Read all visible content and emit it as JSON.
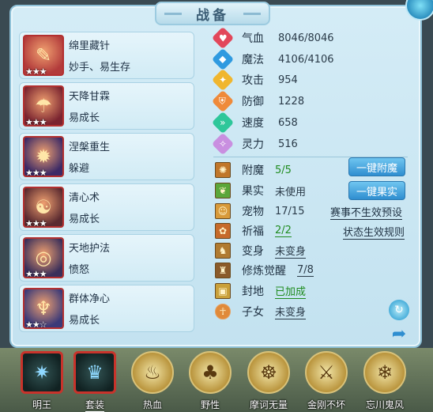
{
  "title": "战备",
  "skills": [
    {
      "name": "绵里藏针",
      "desc": "妙手、易生存",
      "stars": "★★★",
      "icon": "needle-skill-icon",
      "glyph": "✎",
      "bg": "#b23b3b"
    },
    {
      "name": "天降甘霖",
      "desc": "易成长",
      "stars": "★★★",
      "icon": "rain-skill-icon",
      "glyph": "☂",
      "bg": "#7a2430"
    },
    {
      "name": "涅槃重生",
      "desc": "躲避",
      "stars": "★★★",
      "icon": "rebirth-skill-icon",
      "glyph": "✹",
      "bg": "#3c2a66"
    },
    {
      "name": "清心术",
      "desc": "易成长",
      "stars": "★★★",
      "icon": "clear-mind-skill-icon",
      "glyph": "☯",
      "bg": "#5a2a30"
    },
    {
      "name": "天地护法",
      "desc": "愤怒",
      "stars": "★★★",
      "icon": "guardian-skill-icon",
      "glyph": "◎",
      "bg": "#3a2f5a"
    },
    {
      "name": "群体净心",
      "desc": "易成长",
      "stars": "★★☆",
      "icon": "group-purify-skill-icon",
      "glyph": "♆",
      "bg": "#3b3a78"
    }
  ],
  "stats": [
    {
      "label": "气血",
      "value": "8046/8046",
      "icon": "heart-icon",
      "color": "#e2475a",
      "glyph": "♥"
    },
    {
      "label": "魔法",
      "value": "4106/4106",
      "icon": "mana-icon",
      "color": "#2f9ae0",
      "glyph": "◆"
    },
    {
      "label": "攻击",
      "value": "954",
      "icon": "attack-icon",
      "color": "#f0b62e",
      "glyph": "✦"
    },
    {
      "label": "防御",
      "value": "1228",
      "icon": "defense-icon",
      "color": "#ef8a3a",
      "glyph": "⛨"
    },
    {
      "label": "速度",
      "value": "658",
      "icon": "speed-icon",
      "color": "#2ec79a",
      "glyph": "»"
    },
    {
      "label": "灵力",
      "value": "516",
      "icon": "spirit-icon",
      "color": "#c98fe0",
      "glyph": "✧"
    }
  ],
  "attrs": [
    {
      "label": "附魔",
      "value": "5/5",
      "icon": "enchant-icon",
      "glyph": "✺",
      "bg": "#c0762a",
      "green": true,
      "underline": false
    },
    {
      "label": "果实",
      "value": "未使用",
      "icon": "fruit-icon",
      "glyph": "❦",
      "bg": "#5aa63a",
      "green": false,
      "underline": false
    },
    {
      "label": "宠物",
      "value": "17/15",
      "icon": "pet-icon",
      "glyph": "☺",
      "bg": "#d89a3a",
      "green": false,
      "underline": false
    },
    {
      "label": "祈福",
      "value": "2/2",
      "icon": "blessing-icon",
      "glyph": "✿",
      "bg": "#c66a2a",
      "green": true,
      "underline": true
    },
    {
      "label": "变身",
      "value": "未变身",
      "icon": "transform-icon",
      "glyph": "♞",
      "bg": "#b07a30",
      "green": false,
      "underline": true
    },
    {
      "label": "修炼觉醒",
      "value": "7/8",
      "icon": "awaken-icon",
      "glyph": "♜",
      "bg": "#8a5a2a",
      "green": false,
      "underline": true
    },
    {
      "label": "封地",
      "value": "已加成",
      "icon": "territory-icon",
      "glyph": "▣",
      "bg": "#c9a03a",
      "green": true,
      "underline": true
    },
    {
      "label": "子女",
      "value": "未变身",
      "icon": "child-icon",
      "glyph": "☥",
      "bg": "#e08a3a",
      "green": false,
      "underline": true
    }
  ],
  "buttons": {
    "enchant": "一键附魔",
    "fruit": "一键果实"
  },
  "links": {
    "preset_rule": "赛事不生效预设",
    "status_rule": "状态生效规则"
  },
  "bottom": [
    {
      "label": "明王",
      "icon": "ming-wang-icon",
      "glyph": "✷",
      "shape": "sq",
      "underline": false
    },
    {
      "label": "套装",
      "icon": "suit-icon",
      "glyph": "♛",
      "shape": "sq",
      "underline": true
    },
    {
      "label": "热血",
      "icon": "hot-blood-icon",
      "glyph": "♨",
      "shape": "round",
      "underline": false
    },
    {
      "label": "野性",
      "icon": "wild-icon",
      "glyph": "♣",
      "shape": "round",
      "underline": false
    },
    {
      "label": "摩诃无量",
      "icon": "mohe-icon",
      "glyph": "☸",
      "shape": "round",
      "underline": false
    },
    {
      "label": "金刚不坏",
      "icon": "vajra-icon",
      "glyph": "⚔",
      "shape": "round",
      "underline": false
    },
    {
      "label": "忘川鬼风",
      "icon": "ghost-wind-icon",
      "glyph": "❄",
      "shape": "round",
      "underline": false
    }
  ]
}
